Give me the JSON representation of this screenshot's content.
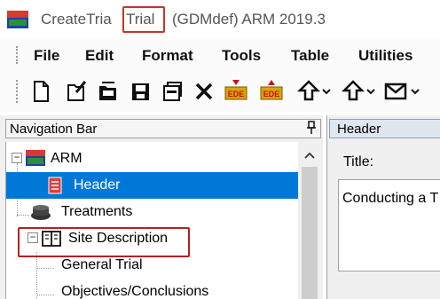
{
  "titlebar": {
    "part1": "CreateTria",
    "trial": "Trial",
    "part2": "(GDMdef) ARM 2019.3"
  },
  "menubar": {
    "items": [
      "File",
      "Edit",
      "Format",
      "Tools",
      "Table",
      "Utilities"
    ]
  },
  "toolbar": {
    "buttons": [
      "new-icon",
      "open-icon",
      "open-folder-icon",
      "save-icon",
      "properties-icon",
      "delete-icon",
      "ede-import-icon",
      "ede-export-icon",
      "upload-icon",
      "download-icon",
      "mail-icon"
    ]
  },
  "navigation": {
    "title": "Navigation Bar",
    "pin": "p",
    "tree": [
      {
        "label": "ARM",
        "expander": "−"
      },
      {
        "label": "Header"
      },
      {
        "label": "Treatments"
      },
      {
        "label": "Site Description",
        "expander": "−"
      },
      {
        "label": "General Trial"
      },
      {
        "label": "Objectives/Conclusions"
      }
    ]
  },
  "rightpane": {
    "header": "Header",
    "title_label": "Title:",
    "title_value": "Conducting a T"
  },
  "colors": {
    "selection": "#0078d7",
    "highlight_box": "#b22222"
  }
}
